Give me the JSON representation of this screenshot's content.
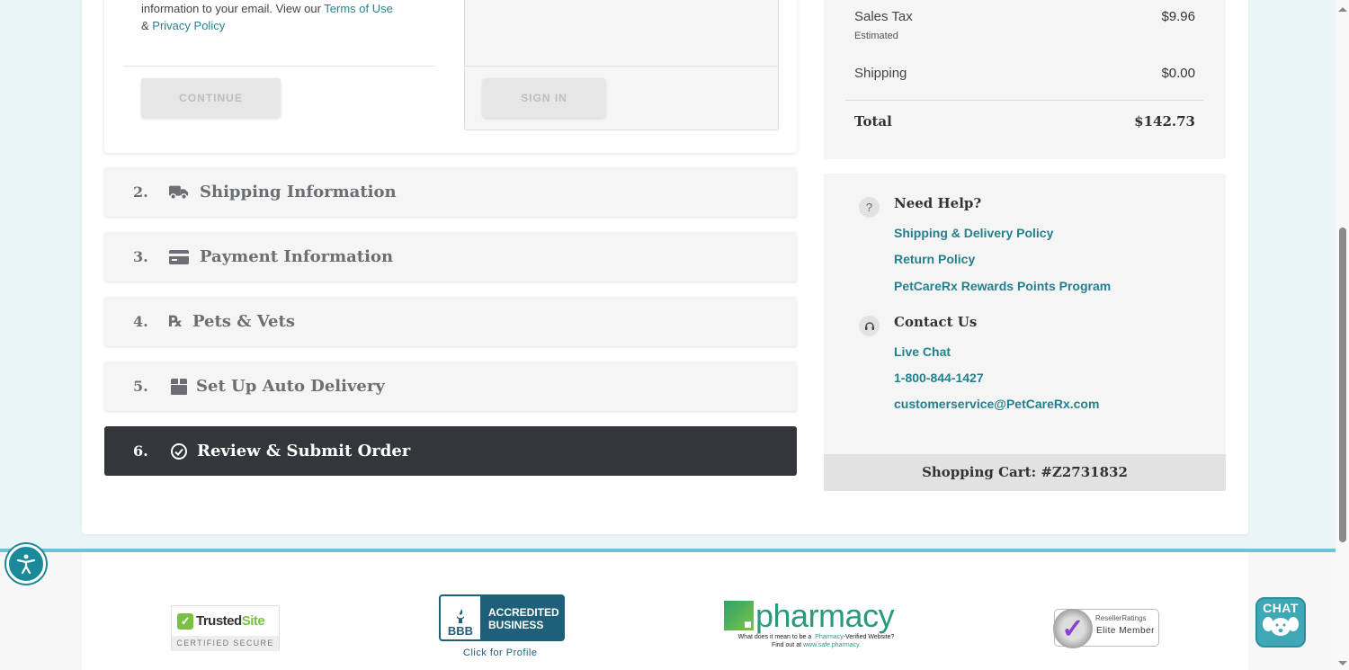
{
  "login": {
    "guest_text_prefix": "information to your email. View our ",
    "terms_link": "Terms of Use",
    "amp": "& ",
    "privacy_link": "Privacy Policy",
    "continue_label": "CONTINUE",
    "signin_label": "SIGN IN"
  },
  "steps": [
    {
      "num": "2.",
      "label": "Shipping Information",
      "icon": "truck-icon"
    },
    {
      "num": "3.",
      "label": "Payment Information",
      "icon": "credit-card-icon"
    },
    {
      "num": "4.",
      "label": "Pets & Vets",
      "icon": "rx-icon"
    },
    {
      "num": "5.",
      "label": "Set Up Auto Delivery",
      "icon": "box-icon"
    },
    {
      "num": "6.",
      "label": "Review & Submit Order",
      "icon": "check-circle-icon",
      "active": true
    }
  ],
  "summary": {
    "sales_tax_label": "Sales Tax",
    "sales_tax_sub": "Estimated",
    "sales_tax_value": "$9.96",
    "shipping_label": "Shipping",
    "shipping_value": "$0.00",
    "total_label": "Total",
    "total_value": "$142.73"
  },
  "help": {
    "need_help_heading": "Need Help?",
    "help_links": [
      "Shipping & Delivery Policy",
      "Return Policy",
      "PetCareRx Rewards Points Program"
    ],
    "contact_heading": "Contact Us",
    "contact_links": [
      "Live Chat",
      "1-800-844-1427",
      "customerservice@PetCareRx.com"
    ],
    "cart_label": "Shopping Cart: #Z2731832"
  },
  "footer": {
    "trusted_site": {
      "trusted": "Trusted",
      "site": "Site",
      "certified": "CERTIFIED SECURE"
    },
    "bbb": {
      "seal": "BBB",
      "accredited": "ACCREDITED",
      "business": "BUSINESS",
      "profile": "Click for Profile"
    },
    "pharmacy": {
      "word": "pharmacy",
      "caption_1": "What does it mean to be a ",
      "caption_1_link": ".Pharmacy",
      "caption_1_end": "-Verified Website?",
      "caption_2": "Find out at ",
      "caption_2_link": "www.safe.pharmacy."
    },
    "reseller": {
      "brand": "ResellerRatings",
      "level": "Elite Member"
    },
    "chat_label": "CHAT"
  },
  "colors": {
    "accent_teal": "#23808f",
    "active_step_bg": "#33363b",
    "footer_line": "#6cc3d3"
  }
}
